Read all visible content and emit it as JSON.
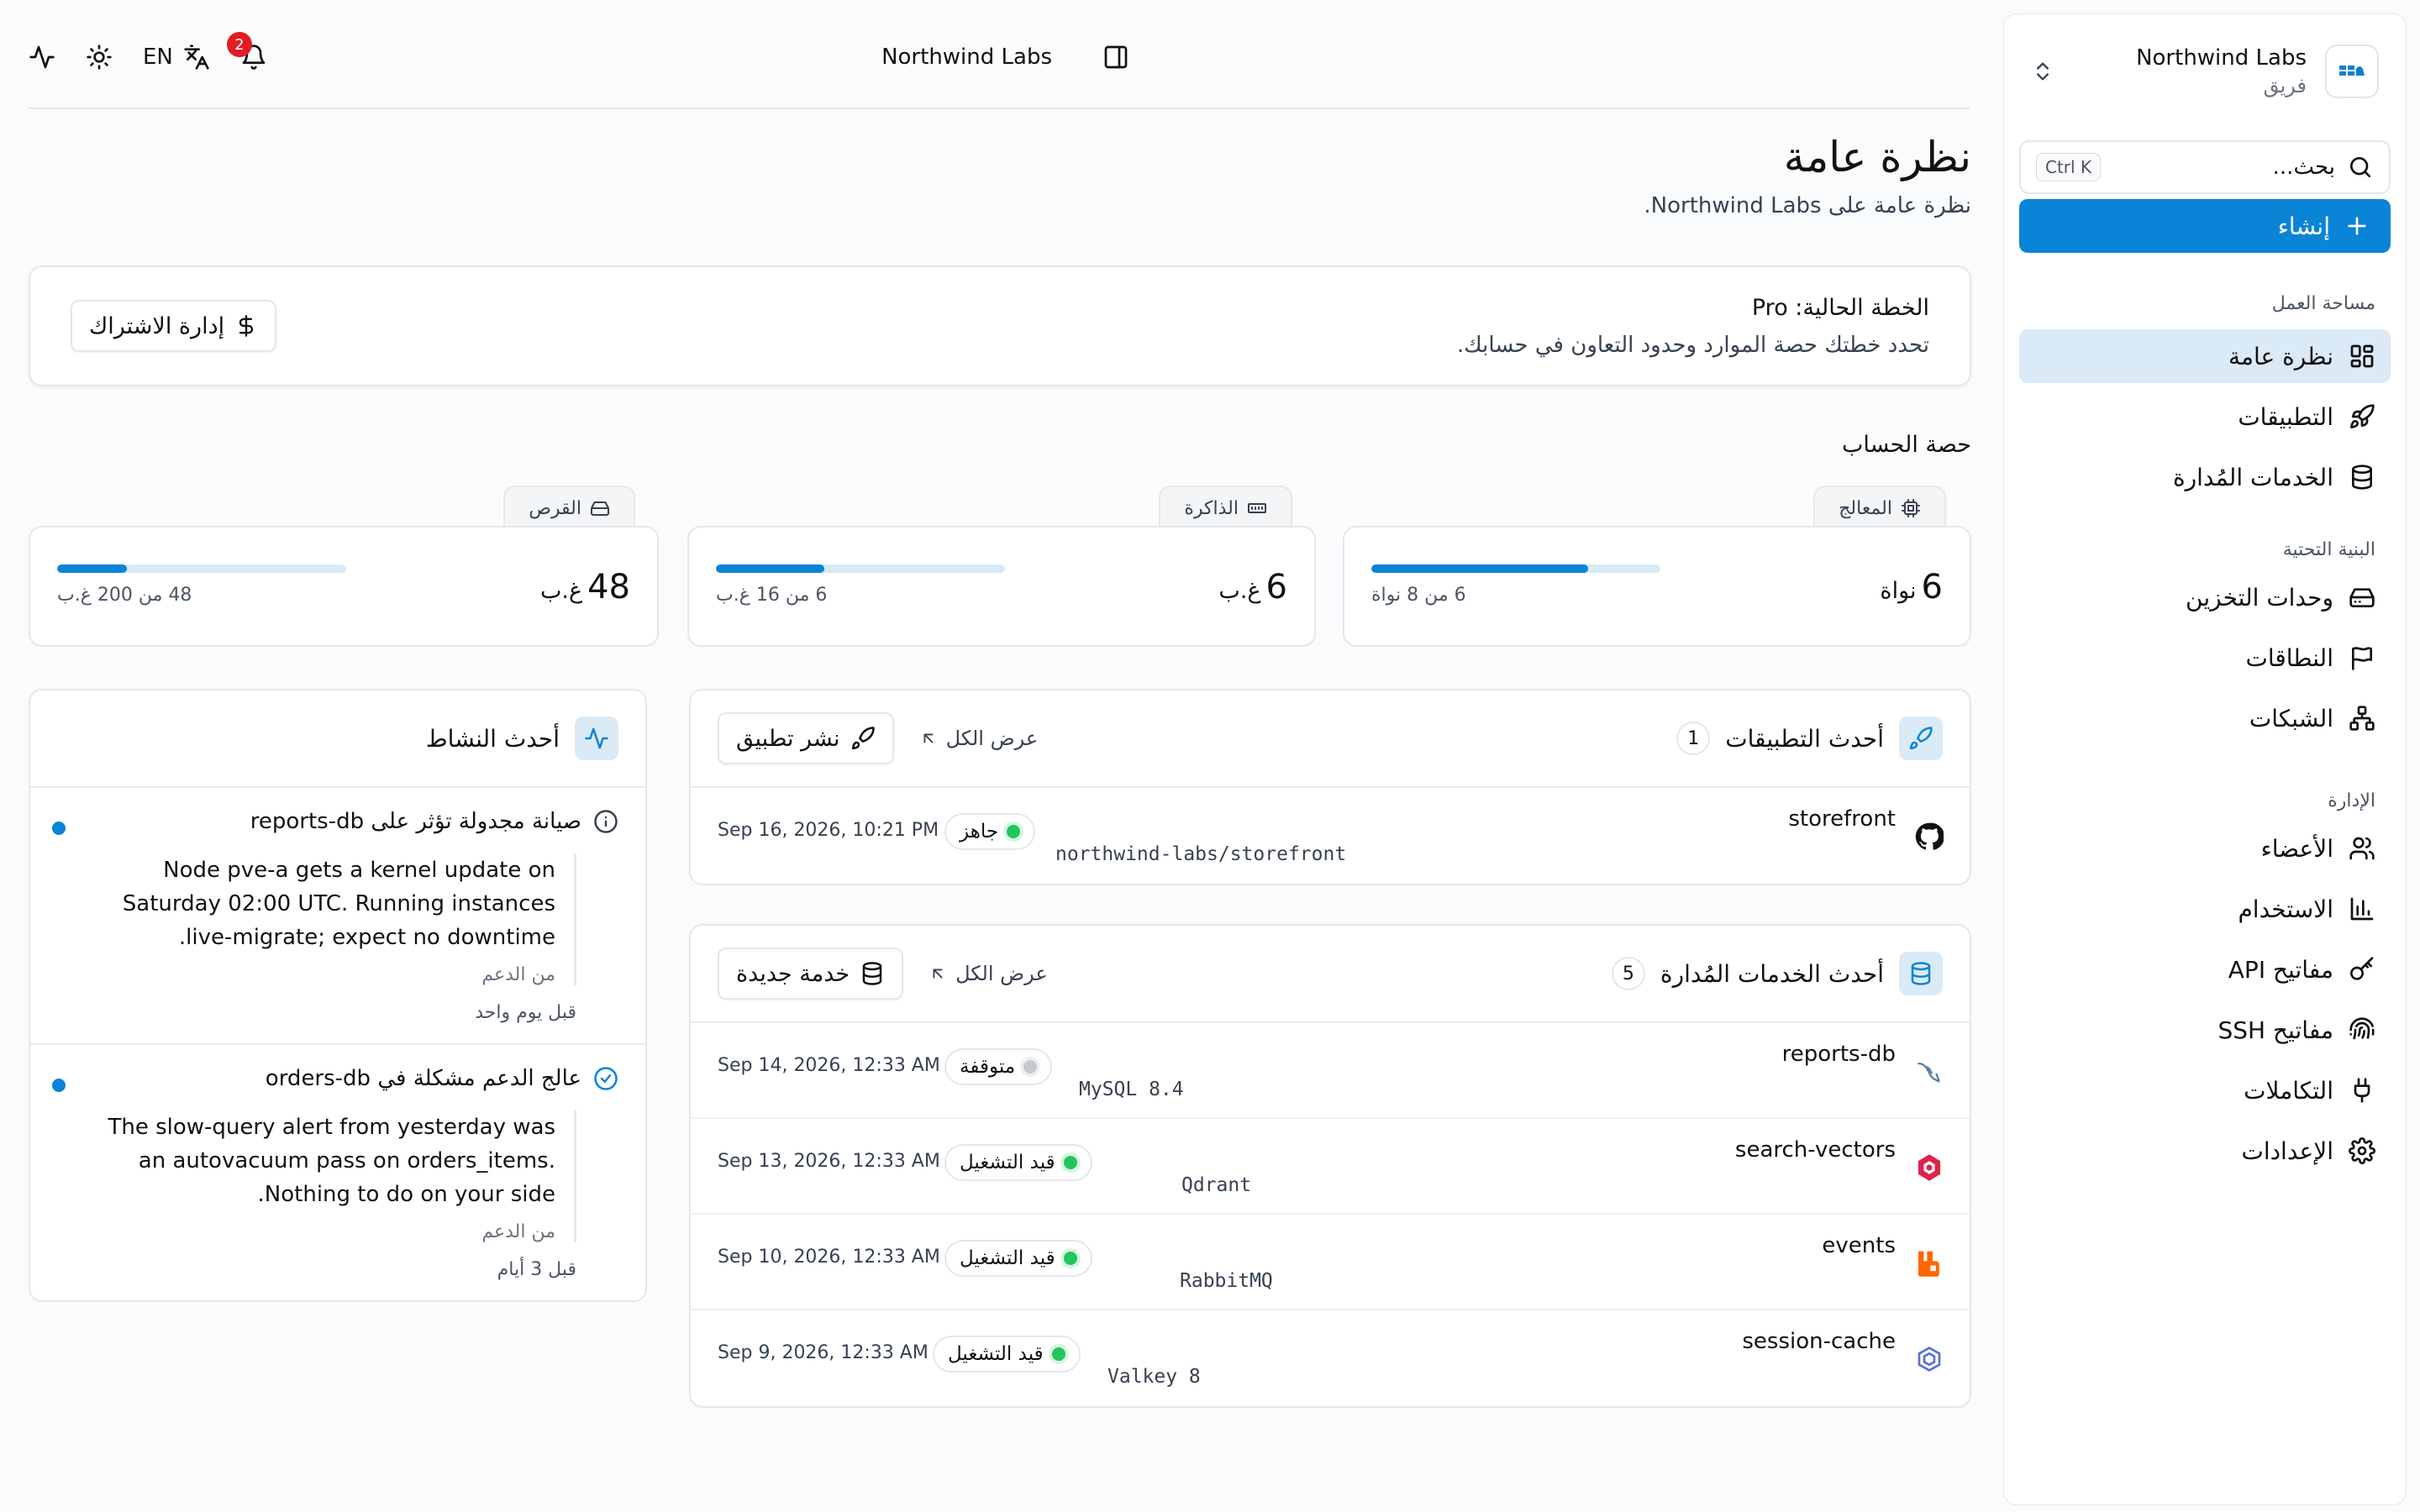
{
  "team": {
    "name": "Northwind Labs",
    "role": "فريق"
  },
  "search": {
    "label": "بحث...",
    "shortcut": "Ctrl K"
  },
  "create_label": "إنشاء",
  "nav": {
    "workspace_label": "مساحة العمل",
    "overview": "نظرة عامة",
    "apps": "التطبيقات",
    "managed": "الخدمات المُدارة",
    "infra_label": "البنية التحتية",
    "storage": "وحدات التخزين",
    "domains": "النطاقات",
    "networks": "الشبكات",
    "admin_label": "الإدارة",
    "members": "الأعضاء",
    "usage": "الاستخدام",
    "api_keys": "مفاتيح API",
    "ssh_keys": "مفاتيح SSH",
    "integrations": "التكاملات",
    "settings": "الإعدادات"
  },
  "topbar": {
    "brand": "Northwind Labs",
    "lang": "EN",
    "notifications": "2"
  },
  "page": {
    "title": "نظرة عامة",
    "subtitle": "نظرة عامة على Northwind Labs."
  },
  "plan": {
    "title": "الخطة الحالية: Pro",
    "desc": "تحدد خطتك حصة الموارد وحدود التعاون في حسابك.",
    "button": "إدارة الاشتراك"
  },
  "quota": {
    "title": "حصة الحساب",
    "cpu": {
      "label": "المعالج",
      "value": "6",
      "unit": "نواة",
      "sub": "6 من 8 نواة",
      "pct": 0.75
    },
    "mem": {
      "label": "الذاكرة",
      "value": "6",
      "unit": "غ.ب",
      "sub": "6 من 16 غ.ب",
      "pct": 0.375
    },
    "disk": {
      "label": "القرص",
      "value": "48",
      "unit": "غ.ب",
      "sub": "48 من 200 غ.ب",
      "pct": 0.24
    }
  },
  "apps": {
    "title": "أحدث التطبيقات",
    "count": "1",
    "view_all": "عرض الكل",
    "deploy": "نشر تطبيق",
    "rows": [
      {
        "name": "storefront",
        "repo": "northwind-labs/storefront",
        "status": "جاهز",
        "date": "Sep 16, 2026, 10:21 PM"
      }
    ]
  },
  "services": {
    "title": "أحدث الخدمات المُدارة",
    "count": "5",
    "view_all": "عرض الكل",
    "new": "خدمة جديدة",
    "rows": [
      {
        "name": "reports-db",
        "engine": "MySQL 8.4",
        "status": "متوقفة",
        "date": "Sep 14, 2026, 12:33 AM"
      },
      {
        "name": "search-vectors",
        "engine": "Qdrant",
        "status": "قيد التشغيل",
        "date": "Sep 13, 2026, 12:33 AM"
      },
      {
        "name": "events",
        "engine": "RabbitMQ",
        "status": "قيد التشغيل",
        "date": "Sep 10, 2026, 12:33 AM"
      },
      {
        "name": "session-cache",
        "engine": "Valkey 8",
        "status": "قيد التشغيل",
        "date": "Sep 9, 2026, 12:33 AM"
      }
    ]
  },
  "activity": {
    "title": "أحدث النشاط",
    "items": [
      {
        "title": "صيانة مجدولة تؤثر على reports-db",
        "text": "Node pve-a gets a kernel update on Saturday 02:00 UTC. Running instances live-migrate; expect no downtime.",
        "from": "من الدعم",
        "time": "قبل يوم واحد"
      },
      {
        "title": "عالج الدعم مشكلة في orders-db",
        "text": "The slow-query alert from yesterday was an autovacuum pass on orders_items. Nothing to do on your side.",
        "from": "من الدعم",
        "time": "قبل 3 أيام"
      }
    ]
  },
  "colors": {
    "accent": "#0a84d6",
    "active_bg": "#dbeaf7",
    "ok": "#22c55e",
    "badge": "#e11d24"
  }
}
